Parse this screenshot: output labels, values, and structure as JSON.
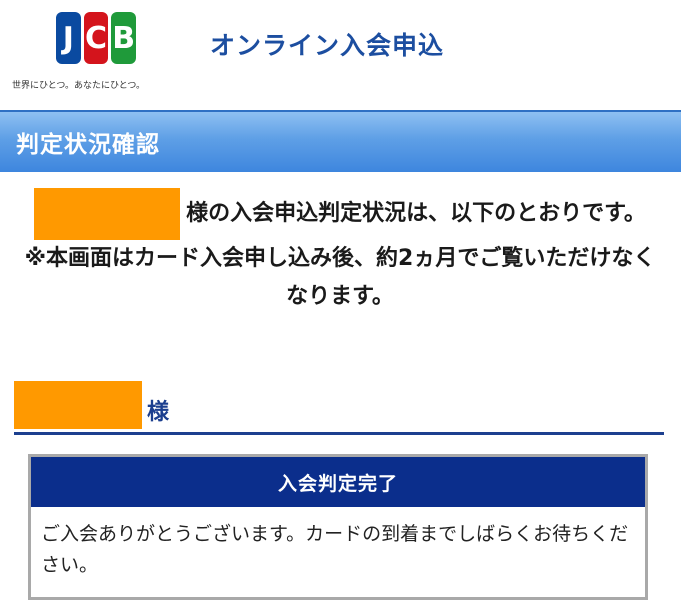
{
  "header": {
    "logo_letters": [
      "J",
      "C",
      "B"
    ],
    "logo_tagline": "世界にひとつ。あなたにひとつ。",
    "title": "オンライン入会申込"
  },
  "section": {
    "title": "判定状況確認"
  },
  "message": {
    "status_text": "様の入会申込判定状況は、以下のとおりです。",
    "notice": "※本画面はカード入会申し込み後、約2ヵ月でご覧いただけなくなります。"
  },
  "name_heading": {
    "suffix": "様"
  },
  "status": {
    "title": "入会判定完了",
    "body": "ご入会ありがとうございます。カードの到着までしばらくお待ちください。"
  },
  "colors": {
    "brand_blue": "#1c4ea0",
    "section_bar": "#5e9fe6",
    "status_header": "#0b2e8c",
    "redaction": "#ff9900",
    "jcb_blue": "#0a4aa0",
    "jcb_red": "#d4141c",
    "jcb_green": "#1f9a3a"
  }
}
